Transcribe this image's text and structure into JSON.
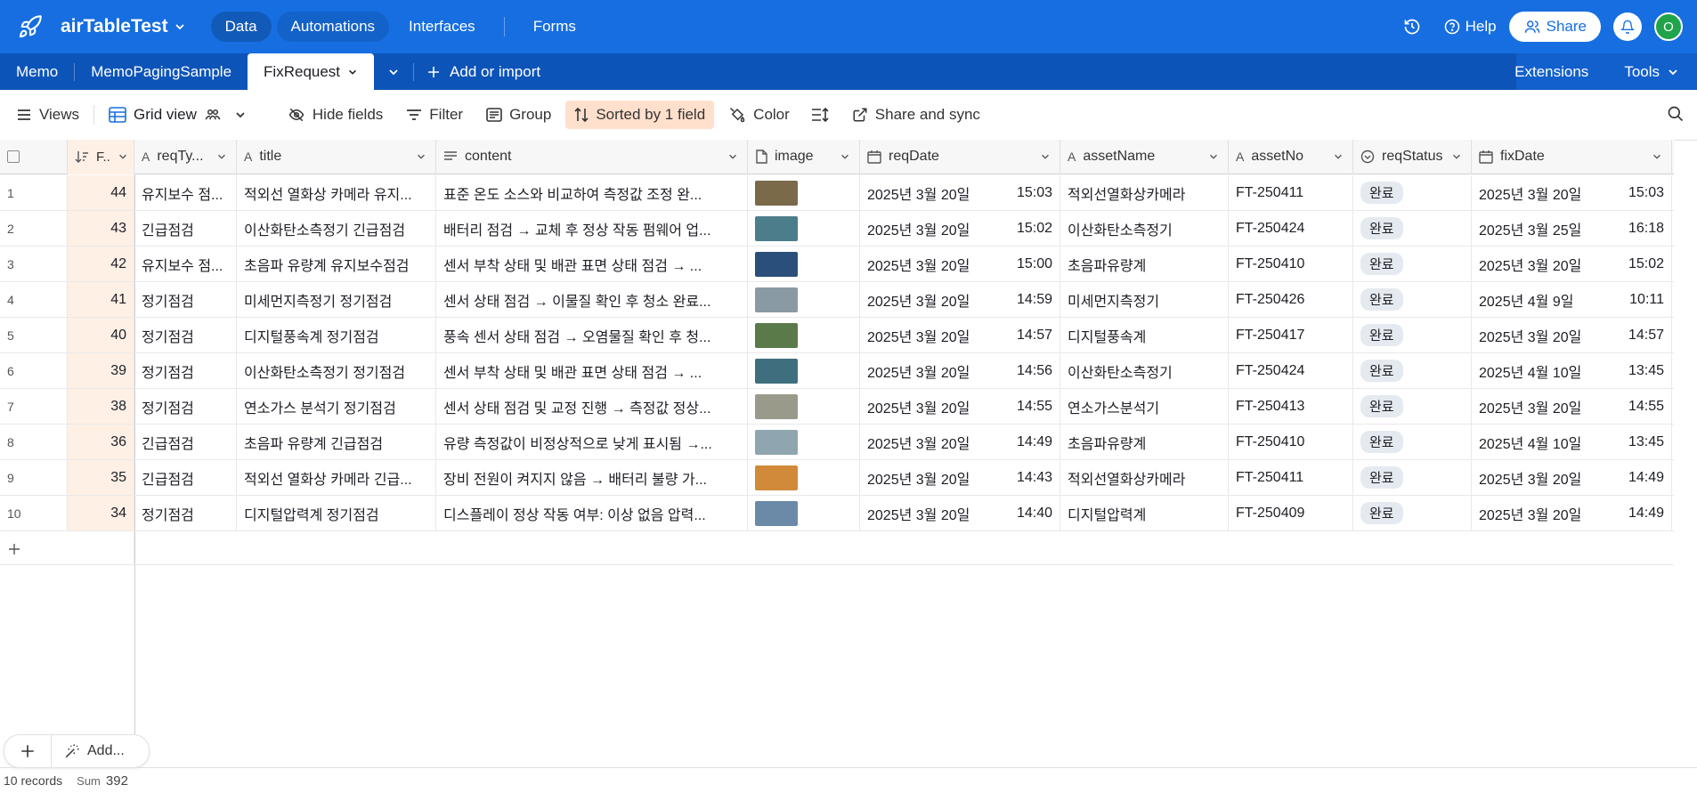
{
  "app": {
    "base_name": "airTableTest",
    "nav": [
      "Data",
      "Automations",
      "Interfaces",
      "Forms"
    ],
    "help": "Help",
    "share": "Share",
    "avatar_letter": "O"
  },
  "tabs": {
    "items": [
      "Memo",
      "MemoPagingSample",
      "FixRequest"
    ],
    "active": "FixRequest",
    "add_import": "Add or import",
    "extensions": "Extensions",
    "tools": "Tools"
  },
  "viewbar": {
    "views": "Views",
    "grid_view": "Grid view",
    "hide_fields": "Hide fields",
    "filter": "Filter",
    "group": "Group",
    "sorted": "Sorted by 1 field",
    "color": "Color",
    "share_sync": "Share and sync"
  },
  "columns": {
    "f": "F..",
    "reqType": "reqTy...",
    "title": "title",
    "content": "content",
    "image": "image",
    "reqDate": "reqDate",
    "assetName": "assetName",
    "assetNo": "assetNo",
    "reqStatus": "reqStatus",
    "fixDate": "fixDate"
  },
  "rows": [
    {
      "n": "1",
      "f": "44",
      "reqType": "유지보수 점...",
      "title": "적외선 열화상 카메라 유지...",
      "content": "표준 온도 소스와 비교하여 측정값 조정 완...",
      "reqDate": "2025년 3월 20일",
      "reqTime": "15:03",
      "assetName": "적외선열화상카메라",
      "assetNo": "FT-250411",
      "status": "완료",
      "fixDate": "2025년 3월 20일",
      "fixTime": "15:03",
      "img": "#7a6a4a"
    },
    {
      "n": "2",
      "f": "43",
      "reqType": "긴급점검",
      "title": "이산화탄소측정기 긴급점검",
      "content": "배터리 점검 → 교체 후 정상 작동 펌웨어 업...",
      "reqDate": "2025년 3월 20일",
      "reqTime": "15:02",
      "assetName": "이산화탄소측정기",
      "assetNo": "FT-250424",
      "status": "완료",
      "fixDate": "2025년 3월 25일",
      "fixTime": "16:18",
      "img": "#4c7d8a"
    },
    {
      "n": "3",
      "f": "42",
      "reqType": "유지보수 점...",
      "title": "초음파 유량계 유지보수점검",
      "content": "센서 부착 상태 및 배관 표면 상태 점검 → ...",
      "reqDate": "2025년 3월 20일",
      "reqTime": "15:00",
      "assetName": "초음파유량계",
      "assetNo": "FT-250410",
      "status": "완료",
      "fixDate": "2025년 3월 20일",
      "fixTime": "15:02",
      "img": "#2a4f7a"
    },
    {
      "n": "4",
      "f": "41",
      "reqType": "정기점검",
      "title": "미세먼지측정기 정기점검",
      "content": "센서 상태 점검 → 이물질 확인 후 청소 완료...",
      "reqDate": "2025년 3월 20일",
      "reqTime": "14:59",
      "assetName": "미세먼지측정기",
      "assetNo": "FT-250426",
      "status": "완료",
      "fixDate": "2025년 4월 9일",
      "fixTime": "10:11",
      "img": "#8a9aa5"
    },
    {
      "n": "5",
      "f": "40",
      "reqType": "정기점검",
      "title": "디지털풍속계 정기점검",
      "content": "풍속 센서 상태 점검 → 오염물질 확인 후 청...",
      "reqDate": "2025년 3월 20일",
      "reqTime": "14:57",
      "assetName": "디지털풍속계",
      "assetNo": "FT-250417",
      "status": "완료",
      "fixDate": "2025년 3월 20일",
      "fixTime": "14:57",
      "img": "#5a7a4a"
    },
    {
      "n": "6",
      "f": "39",
      "reqType": "정기점검",
      "title": "이산화탄소측정기 정기점검",
      "content": "센서 부착 상태 및 배관 표면 상태 점검 → ...",
      "reqDate": "2025년 3월 20일",
      "reqTime": "14:56",
      "assetName": "이산화탄소측정기",
      "assetNo": "FT-250424",
      "status": "완료",
      "fixDate": "2025년 4월 10일",
      "fixTime": "13:45",
      "img": "#3f6f7f"
    },
    {
      "n": "7",
      "f": "38",
      "reqType": "정기점검",
      "title": "연소가스 분석기 정기점검",
      "content": "센서 상태 점검 및 교정 진행 → 측정값 정상...",
      "reqDate": "2025년 3월 20일",
      "reqTime": "14:55",
      "assetName": "연소가스분석기",
      "assetNo": "FT-250413",
      "status": "완료",
      "fixDate": "2025년 3월 20일",
      "fixTime": "14:55",
      "img": "#9a9a8a"
    },
    {
      "n": "8",
      "f": "36",
      "reqType": "긴급점검",
      "title": "초음파 유량계 긴급점검",
      "content": "유량 측정값이 비정상적으로 낮게 표시됨 →...",
      "reqDate": "2025년 3월 20일",
      "reqTime": "14:49",
      "assetName": "초음파유량계",
      "assetNo": "FT-250410",
      "status": "완료",
      "fixDate": "2025년 4월 10일",
      "fixTime": "13:45",
      "img": "#8fa6b0"
    },
    {
      "n": "9",
      "f": "35",
      "reqType": "긴급점검",
      "title": "적외선 열화상 카메라 긴급...",
      "content": "장비 전원이 켜지지 않음 → 배터리 불량 가...",
      "reqDate": "2025년 3월 20일",
      "reqTime": "14:43",
      "assetName": "적외선열화상카메라",
      "assetNo": "FT-250411",
      "status": "완료",
      "fixDate": "2025년 3월 20일",
      "fixTime": "14:49",
      "img": "#d08a3a"
    },
    {
      "n": "10",
      "f": "34",
      "reqType": "정기점검",
      "title": "디지털압력계 정기점검",
      "content": "디스플레이 정상 작동 여부: 이상 없음 압력...",
      "reqDate": "2025년 3월 20일",
      "reqTime": "14:40",
      "assetName": "디지털압력계",
      "assetNo": "FT-250409",
      "status": "완료",
      "fixDate": "2025년 3월 20일",
      "fixTime": "14:49",
      "img": "#6a8aa8"
    }
  ],
  "footer": {
    "records": "10 records",
    "sum_label": "Sum",
    "sum_value": "392",
    "add_label": "Add..."
  },
  "colors": {
    "topbar": "#166ee1",
    "tabbar": "#0d54b8",
    "sorted_bg": "#ffe0cc",
    "sort_column_bg": "#fff0e6"
  }
}
